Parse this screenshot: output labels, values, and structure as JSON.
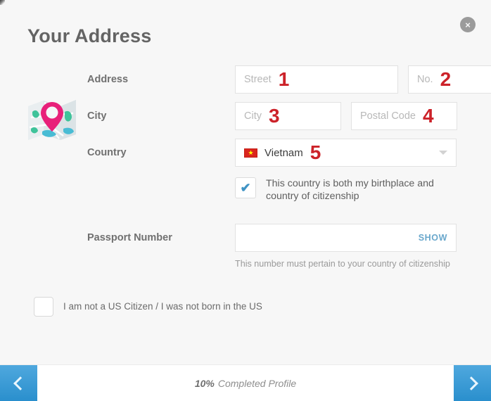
{
  "dialog": {
    "title": "Your Address",
    "close_label": "×",
    "icon": "map-pin-icon"
  },
  "form": {
    "address": {
      "label": "Address",
      "street": {
        "placeholder": "Street",
        "value": "",
        "marker": "1"
      },
      "number": {
        "placeholder": "No.",
        "value": "",
        "marker": "2"
      }
    },
    "city": {
      "label": "City",
      "city": {
        "placeholder": "City",
        "value": "",
        "marker": "3"
      },
      "postal": {
        "placeholder": "Postal Code",
        "value": "",
        "marker": "4"
      }
    },
    "country": {
      "label": "Country",
      "selected": "Vietnam",
      "flag": "vietnam-flag",
      "flag_star": "★",
      "marker": "5"
    },
    "citizenship_checkbox": {
      "checked": true,
      "tick": "✔",
      "text": "This country is both my birthplace and country of citizenship"
    },
    "passport": {
      "label": "Passport Number",
      "value": "",
      "placeholder": "",
      "show_label": "SHOW",
      "hint": "This number must pertain to your country of citizenship"
    },
    "us_citizen_checkbox": {
      "checked": false,
      "text": "I am not a US Citizen / I was not born in the US"
    }
  },
  "footer": {
    "prev_label": "‹",
    "next_label": "›",
    "progress_percent": "10%",
    "progress_text": "Completed Profile"
  },
  "colors": {
    "accent_blue": "#2a8fcd",
    "marker_red": "#cc2229",
    "pin_pink": "#e8207a",
    "flag_red": "#da251d",
    "show_link": "#6aa8cc"
  }
}
